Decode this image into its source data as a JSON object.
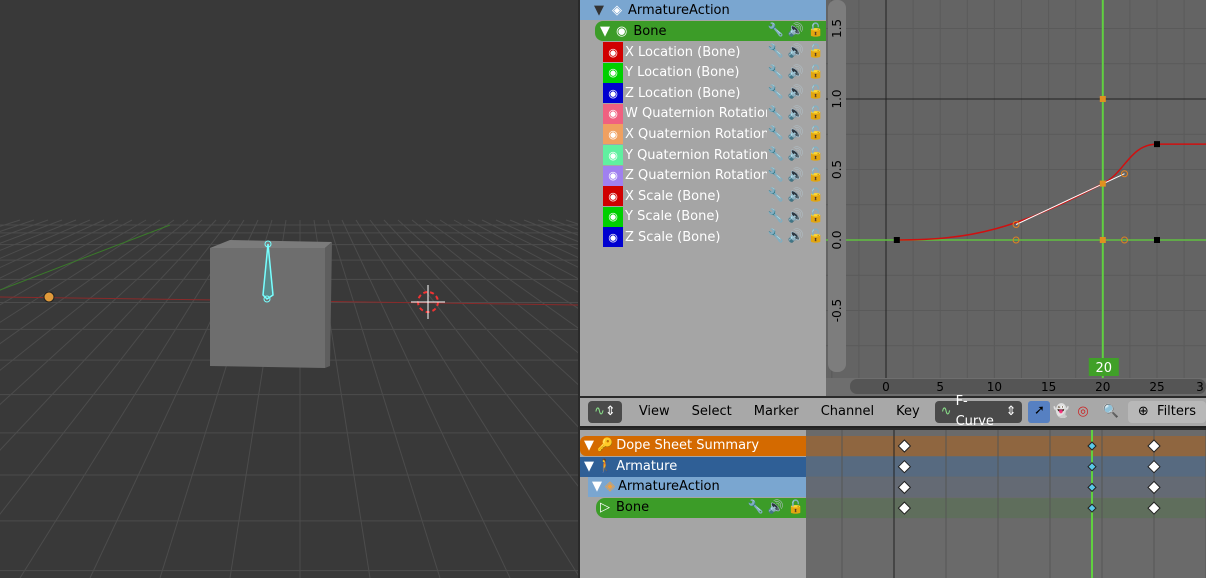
{
  "channels": {
    "action": "ArmatureAction",
    "group": "Bone",
    "items": [
      {
        "label": "X Location (Bone)",
        "color": "#d00000"
      },
      {
        "label": "Y Location (Bone)",
        "color": "#00d000"
      },
      {
        "label": "Z Location (Bone)",
        "color": "#0000d0"
      },
      {
        "label": "W Quaternion Rotation (Bone)",
        "color": "#f06080"
      },
      {
        "label": "X Quaternion Rotation (Bone)",
        "color": "#f0a060"
      },
      {
        "label": "Y Quaternion Rotation (Bone)",
        "color": "#60f0a0"
      },
      {
        "label": "Z Quaternion Rotation (Bone)",
        "color": "#a080f0"
      },
      {
        "label": "X Scale (Bone)",
        "color": "#d00000"
      },
      {
        "label": "Y Scale (Bone)",
        "color": "#00d000"
      },
      {
        "label": "Z Scale (Bone)",
        "color": "#0000d0"
      }
    ]
  },
  "graph": {
    "current_frame": "20",
    "x_ticks": [
      "0",
      "5",
      "10",
      "15",
      "20",
      "25",
      "3"
    ],
    "y_ticks": [
      "1.5",
      "1.0",
      "0.5",
      "0.0",
      "-0.5"
    ],
    "curve": {
      "keys": [
        [
          1,
          0
        ],
        [
          20,
          0.4
        ],
        [
          25,
          0.68
        ]
      ],
      "handles": [
        [
          12,
          0.11
        ],
        [
          22,
          0.47
        ]
      ],
      "color": "#d01010"
    }
  },
  "header": {
    "menus": [
      "View",
      "Select",
      "Marker",
      "Channel",
      "Key"
    ],
    "mode": "F-Curve",
    "filters": "Filters"
  },
  "dopesheet": {
    "rows": [
      {
        "label": "Dope Sheet Summary",
        "color": "#d46a00",
        "track": "#8f6640"
      },
      {
        "label": "Armature",
        "color": "#2f5f96",
        "track": "#576a80"
      },
      {
        "label": "ArmatureAction",
        "color": "#7aa6d0",
        "track": "#646a74"
      },
      {
        "label": "Bone",
        "color": "#3c9c28",
        "track": "#5f6e5c"
      }
    ],
    "keyframes": [
      1,
      20,
      25
    ]
  }
}
